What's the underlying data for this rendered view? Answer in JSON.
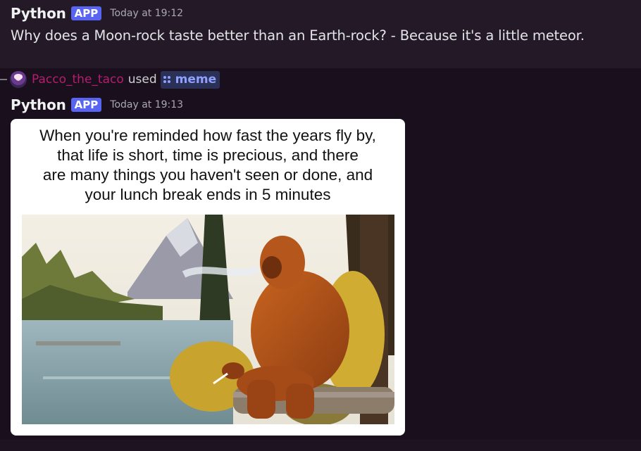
{
  "messages": [
    {
      "author": "Python",
      "badge": "APP",
      "timestamp": "Today at 19:12",
      "content": "Why does a Moon-rock taste better than an Earth-rock? - Because it's a little meteor."
    },
    {
      "author": "Python",
      "badge": "APP",
      "timestamp": "Today at 19:13",
      "interaction": {
        "user": "Pacco_the_taco",
        "verb": "used",
        "command": "meme",
        "command_icon": "app-command-icon"
      },
      "attachment": {
        "caption": "When you're reminded how fast the years fly by,\nthat life is short, time is precious, and there\nare many things you haven't seen or done, and\nyour lunch break ends in 5 minutes",
        "image_subject": "bigfoot-smoking-by-lake-painting"
      }
    }
  ],
  "colors": {
    "app_badge": "#5865f2",
    "username": "#b41e6f",
    "command_text": "#8fa0ff",
    "background": "#1a0f1c"
  }
}
